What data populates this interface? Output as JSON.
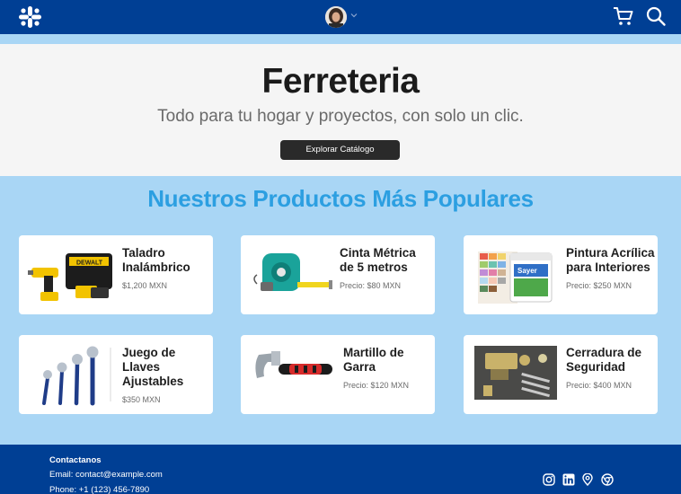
{
  "header": {
    "logo_icon": "slack-like-logo-icon",
    "avatar_icon": "user-avatar",
    "cart_icon": "cart-icon",
    "search_icon": "search-icon",
    "bar_color": "#003f94"
  },
  "hero": {
    "title": "Ferreteria",
    "subtitle": "Todo para tu hogar y proyectos, con solo un clic.",
    "button_label": "Explorar Catálogo"
  },
  "products": {
    "title": "Nuestros Productos Más Populares",
    "accent_color": "#2c9fe1",
    "items": [
      {
        "name_lines": [
          "Taladro",
          "Inalámbrico"
        ],
        "price": "$1,200 MXN",
        "image": "drill-image"
      },
      {
        "name_lines": [
          "Cinta Métrica",
          "de 5 metros"
        ],
        "price": "Precio: $80 MXN",
        "image": "tape-measure-image"
      },
      {
        "name_lines": [
          "Pintura Acrílica",
          "para Interiores"
        ],
        "price": "Precio: $250 MXN",
        "image": "paint-image"
      },
      {
        "name_lines": [
          "Juego de",
          "Llaves",
          "Ajustables"
        ],
        "price": "$350 MXN",
        "image": "wrench-set-image"
      },
      {
        "name_lines": [
          "Martillo de",
          "Garra"
        ],
        "price": "Precio: $120 MXN",
        "image": "hammer-image"
      },
      {
        "name_lines": [
          "Cerradura de",
          "Seguridad"
        ],
        "price": "Precio: $400 MXN",
        "image": "lock-image"
      }
    ]
  },
  "footer": {
    "title": "Contactanos",
    "email": "Email: contact@example.com",
    "phone": "Phone: +1 (123) 456-7890",
    "social_icons": [
      "instagram-icon",
      "linkedin-icon",
      "location-icon",
      "chrome-icon"
    ]
  }
}
